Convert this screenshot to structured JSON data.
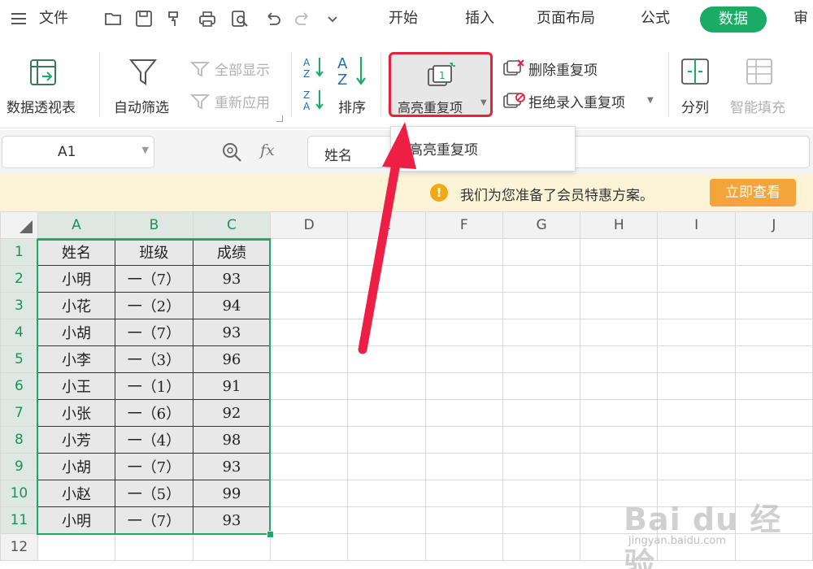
{
  "menu": {
    "file": "文件",
    "tabs": [
      "开始",
      "插入",
      "页面布局",
      "公式",
      "数据",
      "审"
    ]
  },
  "ribbon": {
    "pivot": "数据透视表",
    "autofilter": "自动筛选",
    "show_all": "全部显示",
    "reapply": "重新应用",
    "sort": "排序",
    "highlight_dup": "高亮重复项",
    "delete_dup": "删除重复项",
    "reject_dup": "拒绝录入重复项",
    "split": "分列",
    "smart_fill": "智能填充"
  },
  "dropdown": {
    "item": "高亮重复项"
  },
  "formula_bar": {
    "cell_ref": "A1",
    "fx": "fx",
    "value": "姓名"
  },
  "notice": {
    "icon": "!",
    "message": "我们为您准备了会员特惠方案。",
    "button": "立即查看"
  },
  "sheet": {
    "columns": [
      "A",
      "B",
      "C",
      "D",
      "E",
      "F",
      "G",
      "H",
      "I",
      "J"
    ],
    "row_numbers": [
      "1",
      "2",
      "3",
      "4",
      "5",
      "6",
      "7",
      "8",
      "9",
      "10",
      "11",
      "12"
    ],
    "headers": [
      "姓名",
      "班级",
      "成绩"
    ],
    "rows": [
      [
        "小明",
        "一（7）",
        "93"
      ],
      [
        "小花",
        "一（2）",
        "94"
      ],
      [
        "小胡",
        "一（7）",
        "93"
      ],
      [
        "小李",
        "一（3）",
        "96"
      ],
      [
        "小王",
        "一（1）",
        "91"
      ],
      [
        "小张",
        "一（6）",
        "92"
      ],
      [
        "小芳",
        "一（4）",
        "98"
      ],
      [
        "小胡",
        "一（7）",
        "93"
      ],
      [
        "小赵",
        "一（5）",
        "99"
      ],
      [
        "小明",
        "一（7）",
        "93"
      ]
    ]
  },
  "watermark": {
    "brand": "Bai du 经验",
    "url": "jingyan.baidu.com"
  },
  "colors": {
    "accent": "#1aab65",
    "highlight_border": "#e8213d",
    "notice_bg": "#fdf4d8",
    "notice_button": "#f3a43a"
  }
}
